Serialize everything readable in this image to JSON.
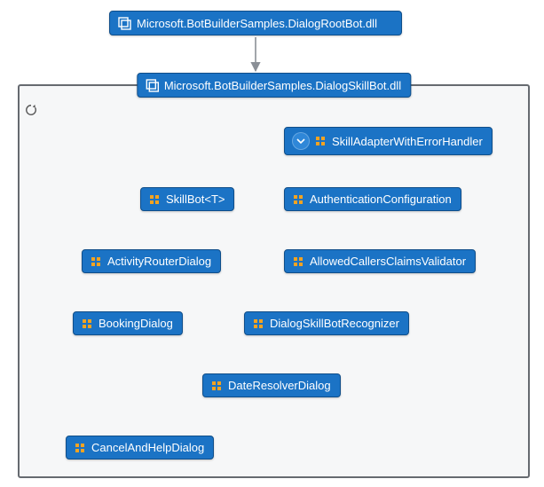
{
  "nodes": {
    "root": "Microsoft.BotBuilderSamples.DialogRootBot.dll",
    "skillContainer": "Microsoft.BotBuilderSamples.DialogSkillBot.dll",
    "skillAdapter": "SkillAdapterWithErrorHandler",
    "skillBot": "SkillBot<T>",
    "authConfig": "AuthenticationConfiguration",
    "activityRouter": "ActivityRouterDialog",
    "allowedCallers": "AllowedCallersClaimsValidator",
    "bookingDialog": "BookingDialog",
    "recognizer": "DialogSkillBotRecognizer",
    "dateResolver": "DateResolverDialog",
    "cancelHelp": "CancelAndHelpDialog"
  },
  "colors": {
    "nodeFill": "#1b73c5",
    "nodeBorder": "#0f4e8a",
    "containerBorder": "#666a70",
    "containerFill": "#f6f7f8",
    "arrowGray": "#8a8f96",
    "arrowMagenta": "#ff00ff",
    "arrowGreen": "#00b300",
    "iconOrange": "#f4a321"
  },
  "chart_data": {
    "type": "dependency-graph",
    "title": "",
    "nodes": [
      {
        "id": "root",
        "label": "Microsoft.BotBuilderSamples.DialogRootBot.dll",
        "kind": "assembly"
      },
      {
        "id": "skillContainer",
        "label": "Microsoft.BotBuilderSamples.DialogSkillBot.dll",
        "kind": "assembly-container"
      },
      {
        "id": "skillAdapter",
        "label": "SkillAdapterWithErrorHandler",
        "kind": "class",
        "expandable": true
      },
      {
        "id": "skillBot",
        "label": "SkillBot<T>",
        "kind": "class"
      },
      {
        "id": "authConfig",
        "label": "AuthenticationConfiguration",
        "kind": "class"
      },
      {
        "id": "activityRouter",
        "label": "ActivityRouterDialog",
        "kind": "class"
      },
      {
        "id": "allowedCallers",
        "label": "AllowedCallersClaimsValidator",
        "kind": "class"
      },
      {
        "id": "bookingDialog",
        "label": "BookingDialog",
        "kind": "class"
      },
      {
        "id": "recognizer",
        "label": "DialogSkillBotRecognizer",
        "kind": "class"
      },
      {
        "id": "dateResolver",
        "label": "DateResolverDialog",
        "kind": "class"
      },
      {
        "id": "cancelHelp",
        "label": "CancelAndHelpDialog",
        "kind": "class"
      }
    ],
    "edges": [
      {
        "from": "root",
        "to": "skillContainer",
        "color": "gray"
      },
      {
        "from": "skillAdapter",
        "to": "skillBot",
        "color": "gray"
      },
      {
        "from": "skillAdapter",
        "to": "authConfig",
        "color": "gray"
      },
      {
        "from": "skillBot",
        "to": "activityRouter",
        "color": "gray"
      },
      {
        "from": "authConfig",
        "to": "allowedCallers",
        "color": "gray"
      },
      {
        "from": "activityRouter",
        "to": "bookingDialog",
        "color": "magenta"
      },
      {
        "from": "activityRouter",
        "to": "recognizer",
        "color": "magenta"
      },
      {
        "from": "bookingDialog",
        "to": "dateResolver",
        "color": "magenta"
      },
      {
        "from": "bookingDialog",
        "to": "cancelHelp",
        "color": "green"
      },
      {
        "from": "dateResolver",
        "to": "cancelHelp",
        "color": "green"
      }
    ]
  }
}
